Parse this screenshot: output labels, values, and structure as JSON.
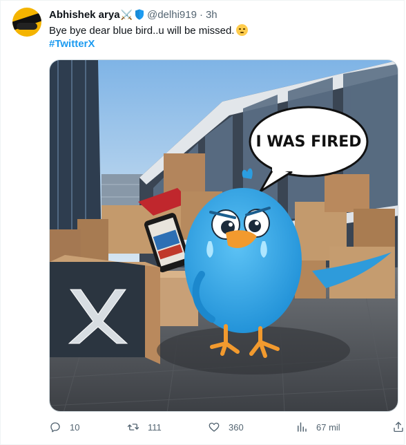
{
  "tweet": {
    "display_name": "Abhishek arya",
    "name_emoji": "⚔️",
    "handle": "@delhi919",
    "separator": "·",
    "time": "3h",
    "text": "Bye bye dear blue bird..u will be missed.",
    "hashtag": "#TwitterX",
    "image": {
      "speech_bubble_text": "I WAS FIRED",
      "box_logo_text": "X"
    }
  },
  "actions": {
    "replies": "10",
    "retweets": "111",
    "likes": "360",
    "views": "67 mil"
  },
  "colors": {
    "link": "#1d9bf0",
    "secondary_text": "#536471",
    "primary_text": "#0f1419",
    "verified_shield": "#1d9bf0"
  },
  "icons": {
    "reply": "speech-bubble-icon",
    "retweet": "retweet-icon",
    "like": "heart-icon",
    "views": "bar-chart-icon",
    "share": "share-icon"
  }
}
